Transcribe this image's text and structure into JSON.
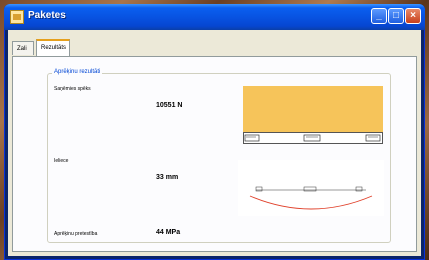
{
  "window": {
    "title": "Paketes",
    "icons": [
      "app-icon",
      "minimize-icon",
      "maximize-icon",
      "close-icon"
    ]
  },
  "tabs": [
    {
      "label": "Zali",
      "active": false
    },
    {
      "label": "Rezultāts",
      "active": true
    }
  ],
  "results": {
    "group_title": "Aprēķinu rezultāti",
    "rows": [
      {
        "label": "Saņēmies spēks",
        "value": "10551 N"
      },
      {
        "label": "Ieliece",
        "value": "33 mm"
      },
      {
        "label": "Aprēķinu pretestība",
        "value": "44 MPa"
      }
    ]
  },
  "colors": {
    "accent_fill": "#f6c45a",
    "deflection_curve": "#e0402a",
    "titlebar": "#0853e2",
    "group_title": "#0046d5"
  }
}
